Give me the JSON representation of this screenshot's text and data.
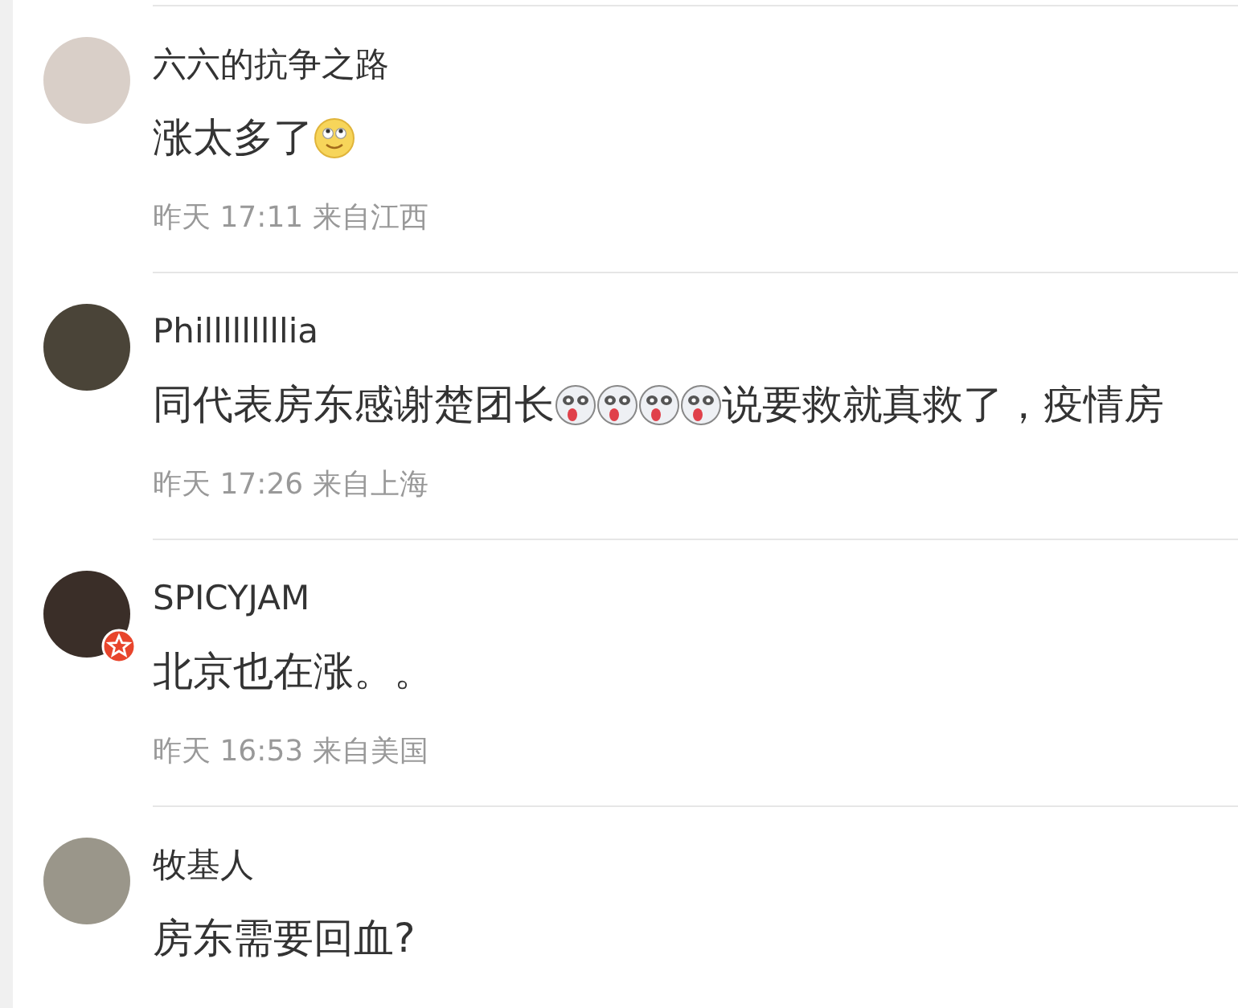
{
  "comments": [
    {
      "user": "六六的抗争之路",
      "verified": false,
      "content": [
        {
          "kind": "text",
          "text": "涨太多了"
        },
        {
          "kind": "smile"
        }
      ],
      "meta": "昨天 17:11 来自江西"
    },
    {
      "user": "Philllllllllia",
      "verified": false,
      "content": [
        {
          "kind": "text",
          "text": "同代表房东感谢楚团长"
        },
        {
          "kind": "tongue"
        },
        {
          "kind": "tongue"
        },
        {
          "kind": "tongue"
        },
        {
          "kind": "tongue"
        },
        {
          "kind": "text",
          "text": "说要救就真救了，疫情房"
        }
      ],
      "meta": "昨天 17:26 来自上海"
    },
    {
      "user": "SPICYJAM",
      "verified": true,
      "content": [
        {
          "kind": "text",
          "text": "北京也在涨。。"
        }
      ],
      "meta": "昨天 16:53 来自美国"
    },
    {
      "user": "牧基人",
      "verified": false,
      "content": [
        {
          "kind": "text",
          "text": "房东需要回血?"
        }
      ]
    }
  ]
}
